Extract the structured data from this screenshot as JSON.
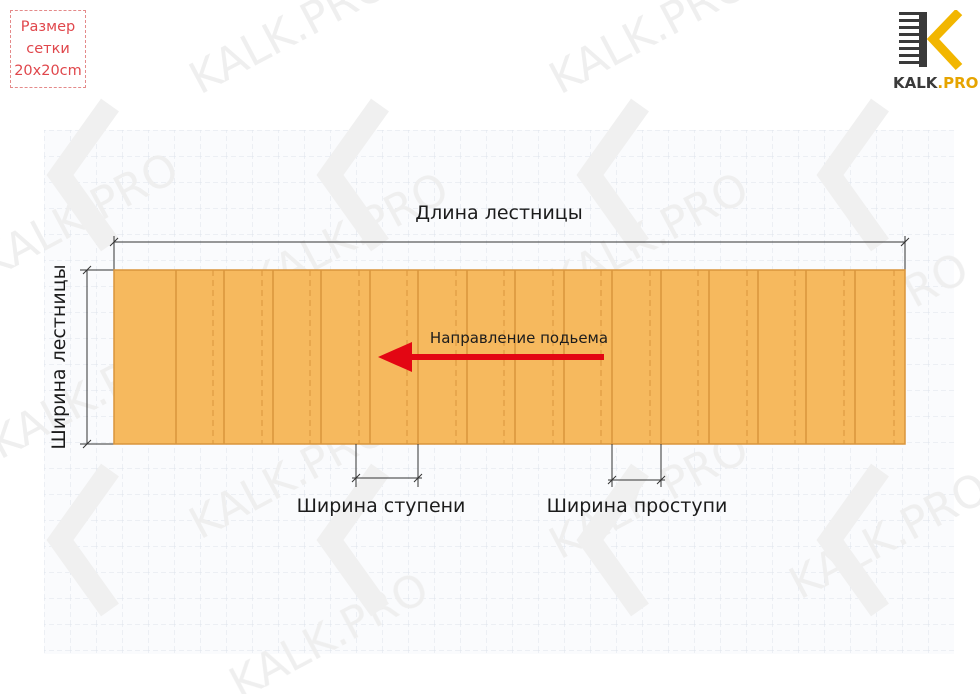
{
  "grid_size_label": {
    "line1": "Размер",
    "line2": "сетки",
    "line3": "20x20cm"
  },
  "logo": {
    "name_main": "KALK",
    "name_dot": ".",
    "name_accent": "PRO",
    "watermark": "KALK.PRO"
  },
  "diagram": {
    "length_label": "Длина лестницы",
    "width_label": "Ширина лестницы",
    "direction_label": "Направление подьема",
    "step_width_label": "Ширина ступени",
    "tread_width_label": "Ширина проступи"
  },
  "colors": {
    "stair_fill": "#f6b95e",
    "stair_stroke": "#d9953c",
    "arrow": "#e30613",
    "grid": "#dde3ec",
    "logo_accent": "#f2b600",
    "logo_dark": "#3a3a3a"
  }
}
